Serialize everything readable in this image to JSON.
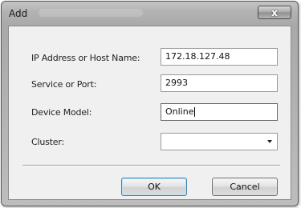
{
  "window": {
    "title": "Add",
    "close_glyph": "x"
  },
  "form": {
    "host_label": "IP Address or Host Name:",
    "host_value": "172.18.127.48",
    "port_label": "Service or Port:",
    "port_value": "2993",
    "model_label": "Device Model:",
    "model_value": "Online",
    "cluster_label": "Cluster:",
    "cluster_value": ""
  },
  "buttons": {
    "ok_label": "OK",
    "cancel_label": "Cancel"
  },
  "icons": {
    "close": "close-icon",
    "dropdown": "chevron-down-icon"
  }
}
